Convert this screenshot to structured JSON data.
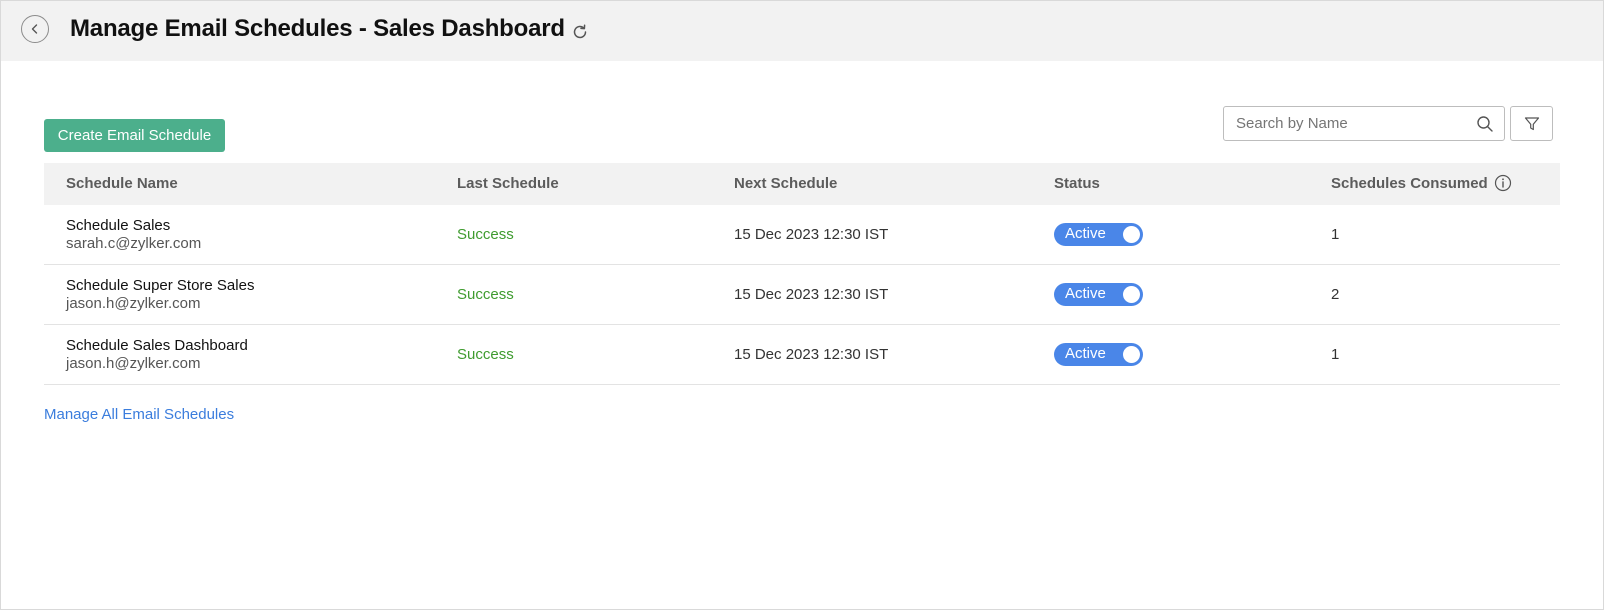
{
  "header": {
    "title": "Manage Email Schedules - Sales Dashboard",
    "back_icon": "chevron-left-icon",
    "refresh_icon": "refresh-icon"
  },
  "toolbar": {
    "create_label": "Create Email Schedule",
    "search_placeholder": "Search by Name",
    "search_value": "",
    "filter_icon": "filter-icon"
  },
  "table": {
    "columns": [
      "Schedule Name",
      "Last Schedule",
      "Next Schedule",
      "Status",
      "Schedules Consumed"
    ],
    "rows": [
      {
        "name": "Schedule Sales",
        "email": "sarah.c@zylker.com",
        "last": "Success",
        "next": "15 Dec 2023 12:30 IST",
        "status": "Active",
        "consumed": "1"
      },
      {
        "name": "Schedule Super Store Sales",
        "email": "jason.h@zylker.com",
        "last": "Success",
        "next": "15 Dec 2023 12:30 IST",
        "status": "Active",
        "consumed": "2"
      },
      {
        "name": "Schedule Sales Dashboard",
        "email": "jason.h@zylker.com",
        "last": "Success",
        "next": "15 Dec 2023 12:30 IST",
        "status": "Active",
        "consumed": "1"
      }
    ]
  },
  "footer": {
    "manage_all_label": "Manage All Email Schedules"
  },
  "colors": {
    "accent_green": "#4caf8c",
    "success_text": "#3f9b2f",
    "toggle_blue": "#4a86e8",
    "link_blue": "#3b7ddd"
  }
}
